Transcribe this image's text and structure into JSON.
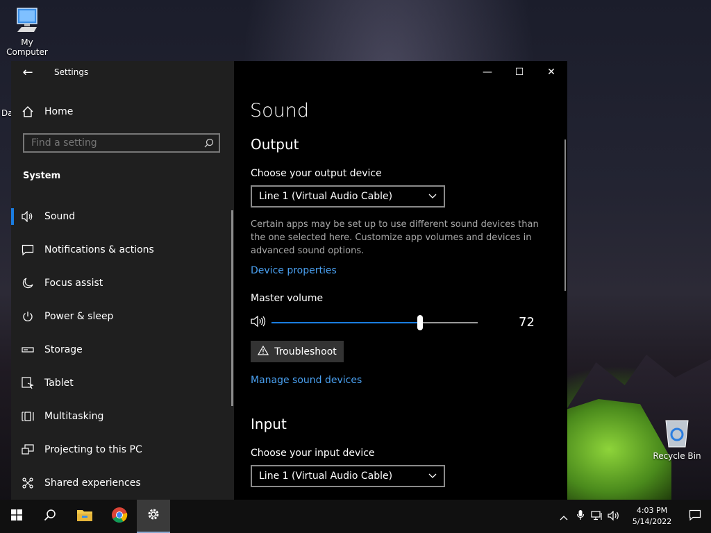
{
  "desktop": {
    "icons": [
      {
        "label": "My Computer",
        "icon": "computer-icon"
      },
      {
        "label": "Recycle Bin",
        "icon": "recycle-bin-icon"
      }
    ],
    "partial_icon_label": "Da"
  },
  "window": {
    "title": "Settings",
    "back_icon": "back-arrow-icon",
    "controls": {
      "minimize": "—",
      "maximize": "☐",
      "close": "✕"
    }
  },
  "sidebar": {
    "home_label": "Home",
    "search": {
      "placeholder": "Find a setting"
    },
    "section_label": "System",
    "items": [
      {
        "label": "Sound",
        "icon": "speaker-icon",
        "active": true
      },
      {
        "label": "Notifications & actions",
        "icon": "message-icon"
      },
      {
        "label": "Focus assist",
        "icon": "moon-icon"
      },
      {
        "label": "Power & sleep",
        "icon": "power-icon"
      },
      {
        "label": "Storage",
        "icon": "storage-icon"
      },
      {
        "label": "Tablet",
        "icon": "tablet-icon"
      },
      {
        "label": "Multitasking",
        "icon": "multitasking-icon"
      },
      {
        "label": "Projecting to this PC",
        "icon": "projecting-icon"
      },
      {
        "label": "Shared experiences",
        "icon": "shared-icon"
      }
    ]
  },
  "main": {
    "title": "Sound",
    "output": {
      "heading": "Output",
      "device_label": "Choose your output device",
      "device_value": "Line 1 (Virtual Audio Cable)",
      "description": "Certain apps may be set up to use different sound devices than the one selected here. Customize app volumes and devices in advanced sound options.",
      "device_properties_link": "Device properties",
      "master_volume_label": "Master volume",
      "master_volume_value": "72",
      "master_volume_fraction": 0.72,
      "troubleshoot_label": "Troubleshoot",
      "manage_link": "Manage sound devices"
    },
    "input": {
      "heading": "Input",
      "device_label": "Choose your input device",
      "device_value": "Line 1 (Virtual Audio Cable)"
    }
  },
  "taskbar": {
    "apps": [
      "start-icon",
      "search-icon",
      "file-explorer-icon",
      "chrome-icon",
      "settings-icon"
    ],
    "active_app": "settings-icon",
    "clock": {
      "time": "4:03 PM",
      "date": "5/14/2022"
    }
  },
  "colors": {
    "accent": "#1a7de0",
    "link": "#4aa0f0",
    "sidebar_bg": "#1f1f1f",
    "content_bg": "#000000"
  }
}
